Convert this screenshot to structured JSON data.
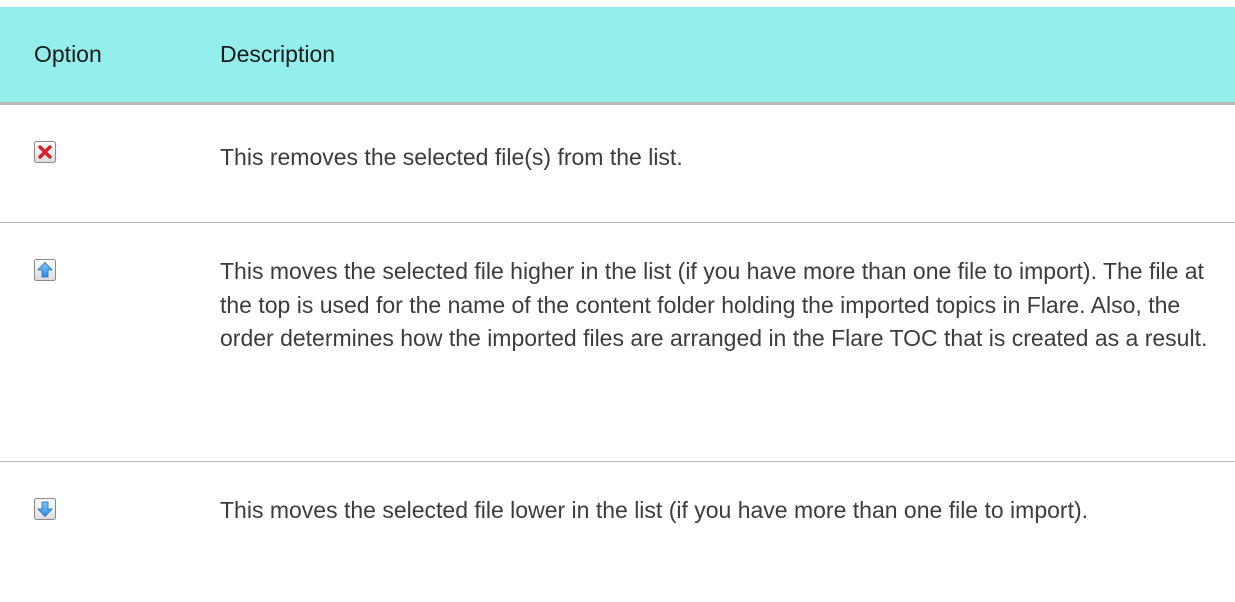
{
  "table": {
    "header": {
      "option": "Option",
      "description": "Description"
    },
    "rows": [
      {
        "icon": "remove-icon",
        "description": "This removes the selected file(s) from the list."
      },
      {
        "icon": "move-up-icon",
        "description": "This moves the selected file higher in the list (if you have more than one file to import). The file at the top is used for the name of the content folder holding the imported topics in Flare. Also, the order determines how the imported files are arranged in the Flare TOC that is created as a result."
      },
      {
        "icon": "move-down-icon",
        "description": "This moves the selected file lower in the list (if you have more than one file to import)."
      }
    ]
  },
  "colors": {
    "header_background": "#93eeec",
    "remove_icon": "#d6202b",
    "arrow_icon": "#2f8fe0"
  }
}
